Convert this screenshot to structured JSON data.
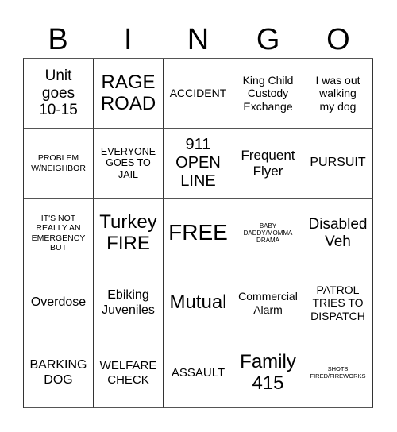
{
  "card": {
    "header": [
      "B",
      "I",
      "N",
      "G",
      "O"
    ],
    "rows": [
      [
        "Unit goes 10-15",
        "RAGE ROAD",
        "ACCIDENT",
        "King Child Custody Exchange",
        "I was out walking my dog"
      ],
      [
        "PROBLEM W/NEIGHBOR",
        "EVERYONE GOES TO JAIL",
        "911 OPEN LINE",
        "Frequent Flyer",
        "PURSUIT"
      ],
      [
        "IT'S NOT REALLY AN EMERGENCY BUT",
        "Turkey FIRE",
        "FREE",
        "BABY DADDY/MOMMA DRAMA",
        "Disabled Veh"
      ],
      [
        "Overdose",
        "Ebiking Juveniles",
        "Mutual",
        "Commercial Alarm",
        "PATROL TRIES TO DISPATCH"
      ],
      [
        "BARKING DOG",
        "WELFARE CHECK",
        "ASSAULT",
        "Family 415",
        "SHOTS FIRED/FIREWORKS"
      ]
    ],
    "free_space": "FREE"
  }
}
